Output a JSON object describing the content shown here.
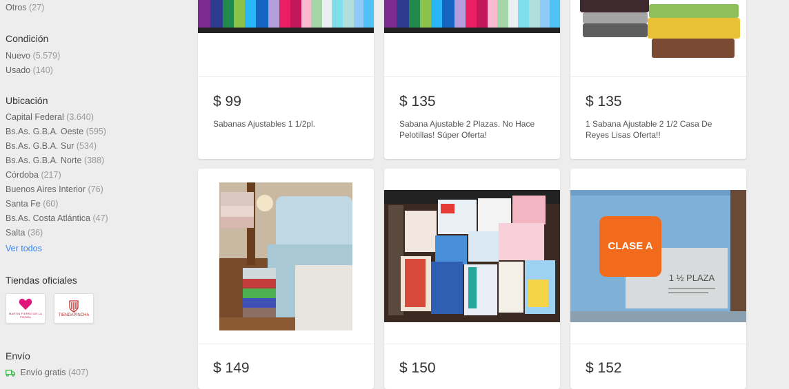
{
  "sidebar": {
    "otros": {
      "label": "Otros",
      "count": "(27)"
    },
    "condicion": {
      "title": "Condición",
      "items": [
        {
          "label": "Nuevo",
          "count": "(5.579)"
        },
        {
          "label": "Usado",
          "count": "(140)"
        }
      ]
    },
    "ubicacion": {
      "title": "Ubicación",
      "items": [
        {
          "label": "Capital Federal",
          "count": "(3.640)"
        },
        {
          "label": "Bs.As. G.B.A. Oeste",
          "count": "(595)"
        },
        {
          "label": "Bs.As. G.B.A. Sur",
          "count": "(534)"
        },
        {
          "label": "Bs.As. G.B.A. Norte",
          "count": "(388)"
        },
        {
          "label": "Córdoba",
          "count": "(217)"
        },
        {
          "label": "Buenos Aires Interior",
          "count": "(76)"
        },
        {
          "label": "Santa Fe",
          "count": "(60)"
        },
        {
          "label": "Bs.As. Costa Atlántica",
          "count": "(47)"
        },
        {
          "label": "Salta",
          "count": "(36)"
        }
      ],
      "ver_todos": "Ver todos"
    },
    "tiendas": {
      "title": "Tiendas oficiales",
      "logos": [
        {
          "name": "heart-store-logo",
          "caption": "MARTIN FIERRO DE LA PIEDRA"
        },
        {
          "name": "tiendapincha-logo",
          "caption": "TIENDAPINCHA"
        }
      ]
    },
    "envio": {
      "title": "Envío",
      "item": {
        "label": "Envío gratis",
        "count": "(407)"
      }
    }
  },
  "products": [
    {
      "price": "$ 99",
      "title": "Sabanas Ajustables 1 1/2pl.",
      "image": "colorful-folded-sheets"
    },
    {
      "price": "$ 135",
      "title": "Sabana Ajustable 2 Plazas. No Hace Pelotillas! Súper Oferta!",
      "image": "colorful-folded-sheets"
    },
    {
      "price": "$ 135",
      "title": "1 Sabana Ajustable 2 1/2 Casa De Reyes Lisas Oferta!!",
      "image": "stacked-color-sheets"
    },
    {
      "price": "$ 149",
      "title": "",
      "image": "bedroom-bed-sheets"
    },
    {
      "price": "$ 150",
      "title": "",
      "image": "kids-printed-sheet-packs"
    },
    {
      "price": "$ 152",
      "title": "",
      "image": "clase-a-sheet-package",
      "brand_text": "CLASE A",
      "size_text": "1 ½ PLAZA"
    }
  ]
}
